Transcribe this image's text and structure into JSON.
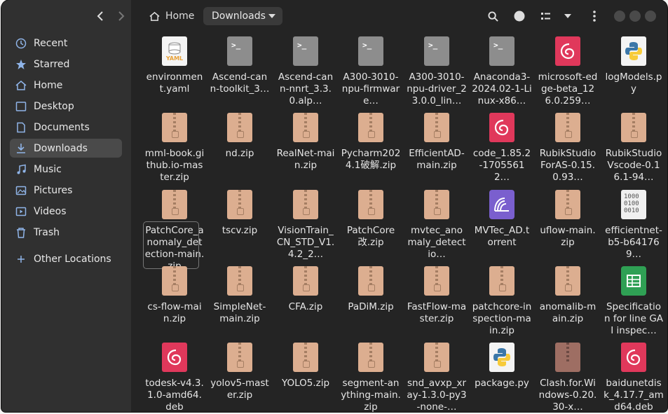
{
  "sidebar": {
    "items": [
      {
        "label": "Recent",
        "icon": "clock-icon"
      },
      {
        "label": "Starred",
        "icon": "star-icon"
      },
      {
        "label": "Home",
        "icon": "home-icon"
      },
      {
        "label": "Desktop",
        "icon": "desktop-icon"
      },
      {
        "label": "Documents",
        "icon": "document-icon"
      },
      {
        "label": "Downloads",
        "icon": "download-icon",
        "active": true
      },
      {
        "label": "Music",
        "icon": "music-icon"
      },
      {
        "label": "Pictures",
        "icon": "picture-icon"
      },
      {
        "label": "Videos",
        "icon": "video-icon"
      },
      {
        "label": "Trash",
        "icon": "trash-icon"
      }
    ],
    "other_locations": "Other Locations"
  },
  "breadcrumb": {
    "home": "Home",
    "current": "Downloads"
  },
  "files": [
    {
      "name": "environment.yaml",
      "type": "yaml"
    },
    {
      "name": "Ascend-cann-toolkit_3…",
      "type": "term"
    },
    {
      "name": "Ascend-cann-nnrt_3.3.0.alp…",
      "type": "term"
    },
    {
      "name": "A300-3010-npu-firmware…",
      "type": "term"
    },
    {
      "name": "A300-3010-npu-driver_23.0.0_lin…",
      "type": "term"
    },
    {
      "name": "Anaconda3-2024.02-1-Linux-x86…",
      "type": "term"
    },
    {
      "name": "microsoft-edge-beta_126.0.259…",
      "type": "deb"
    },
    {
      "name": "logModels.py",
      "type": "py"
    },
    {
      "name": "mml-book.github.io-master.zip",
      "type": "zip"
    },
    {
      "name": "nd.zip",
      "type": "zip"
    },
    {
      "name": "RealNet-main.zip",
      "type": "zip"
    },
    {
      "name": "Pycharm2024.1破解.zip",
      "type": "zip"
    },
    {
      "name": "EfficientAD-main.zip",
      "type": "zip"
    },
    {
      "name": "code_1.85.2-17055612…",
      "type": "deb"
    },
    {
      "name": "RubikStudioForAS-0.15.0.93…",
      "type": "zip"
    },
    {
      "name": "RubikStudioVscode-0.16.1-94…",
      "type": "zip"
    },
    {
      "name": "PatchCore_anomaly_detection-main.zip",
      "type": "zip",
      "focused": true
    },
    {
      "name": "tscv.zip",
      "type": "zip"
    },
    {
      "name": "VisionTrain_CN_STD_V1.4.2_2…",
      "type": "zip"
    },
    {
      "name": "PatchCore改.zip",
      "type": "zip"
    },
    {
      "name": "mvtec_anomaly_detectio…",
      "type": "zip"
    },
    {
      "name": "MVTec_AD.torrent",
      "type": "torrent"
    },
    {
      "name": "uflow-main.zip",
      "type": "zip"
    },
    {
      "name": "efficientnet-b5-b641769…",
      "type": "bin"
    },
    {
      "name": "cs-flow-main.zip",
      "type": "zip"
    },
    {
      "name": "SimpleNet-main.zip",
      "type": "zip"
    },
    {
      "name": "CFA.zip",
      "type": "zip"
    },
    {
      "name": "PaDiM.zip",
      "type": "zip"
    },
    {
      "name": "FastFlow-master.zip",
      "type": "zip"
    },
    {
      "name": "patchcore-inspection-main.zip",
      "type": "zip"
    },
    {
      "name": "anomalib-main.zip",
      "type": "zip"
    },
    {
      "name": "Specification for line GAI inspec…",
      "type": "sheet"
    },
    {
      "name": "todesk-v4.3.1.0-amd64.deb",
      "type": "deb"
    },
    {
      "name": "yolov5-master.zip",
      "type": "zip"
    },
    {
      "name": "YOLO5.zip",
      "type": "zip"
    },
    {
      "name": "segment-anything-main.zip",
      "type": "zip"
    },
    {
      "name": "snd_avxp_xray-1.3.0-py3-none-…",
      "type": "zip"
    },
    {
      "name": "package.py",
      "type": "py"
    },
    {
      "name": "Clash.for.Windows-0.20.30-x…",
      "type": "clash"
    },
    {
      "name": "baidunetdisk_4.17.7_amd64.deb",
      "type": "deb"
    }
  ],
  "colors": {
    "window_bg": "#242424",
    "sidebar_bg": "#303030",
    "active_item": "#4a4a4a",
    "zip": "#dcae90",
    "deb": "#e0385b"
  }
}
